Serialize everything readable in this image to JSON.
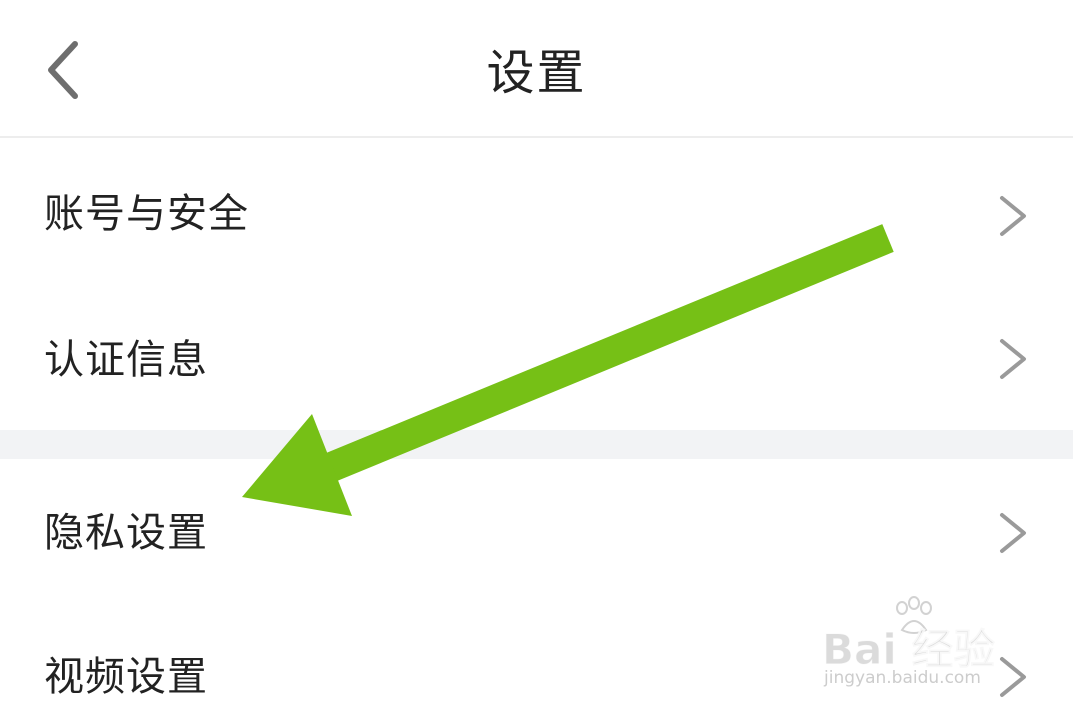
{
  "header": {
    "title": "设置",
    "back_icon": "chevron-left-icon"
  },
  "menu": {
    "items": [
      {
        "label": "账号与安全"
      },
      {
        "label": "认证信息"
      },
      {
        "label": "隐私设置"
      },
      {
        "label": "视频设置"
      }
    ]
  },
  "annotation": {
    "arrow_color": "#76c016"
  },
  "watermark": {
    "logo": "Bai 经验",
    "url": "jingyan.baidu.com"
  },
  "colors": {
    "background": "#ffffff",
    "section_gap": "#f2f3f5",
    "divider": "#ededed",
    "text": "#222222",
    "chevron": "#9a9a9a"
  }
}
